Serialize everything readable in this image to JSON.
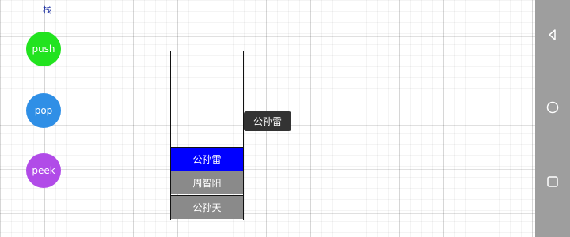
{
  "header": {
    "title": "栈"
  },
  "controls": {
    "push": {
      "label": "push",
      "color": "#22e31f"
    },
    "pop": {
      "label": "pop",
      "color": "#2f8fe6"
    },
    "peek": {
      "label": "peek",
      "color": "#b14be8"
    }
  },
  "tooltip": {
    "text": "公孙雷"
  },
  "stack": {
    "items": [
      {
        "label": "公孙雷",
        "color": "#0000ff"
      },
      {
        "label": "周智阳",
        "color": "#8a8a8a"
      },
      {
        "label": "公孙天",
        "color": "#8a8a8a"
      }
    ]
  },
  "navbar": {
    "back_icon": "back-triangle-icon",
    "home_icon": "home-circle-icon",
    "recent_icon": "recent-square-icon"
  }
}
